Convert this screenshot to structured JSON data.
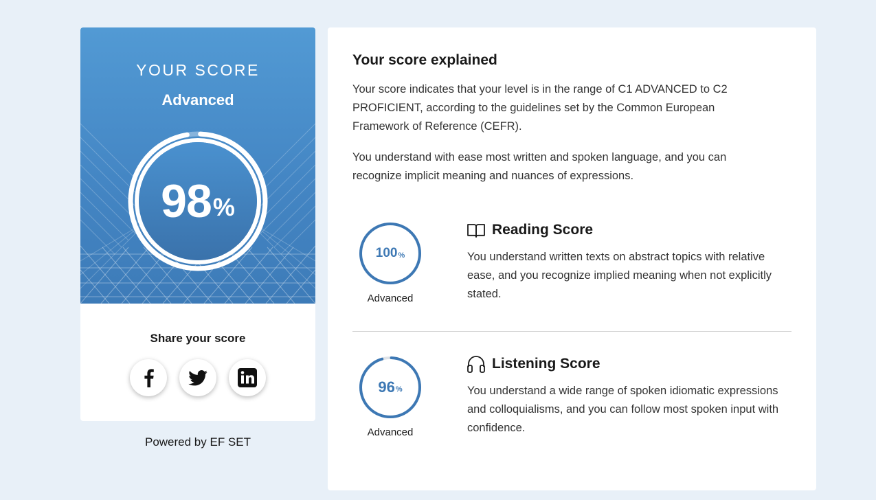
{
  "score_card": {
    "title": "YOUR SCORE",
    "level": "Advanced",
    "score": "98",
    "unit": "%",
    "progress": 0.98,
    "share_title": "Share your score",
    "social": [
      {
        "network": "facebook",
        "icon": "facebook-icon"
      },
      {
        "network": "twitter",
        "icon": "twitter-icon"
      },
      {
        "network": "linkedin",
        "icon": "linkedin-icon"
      }
    ]
  },
  "powered_by": "Powered by EF SET",
  "explanation": {
    "title": "Your score explained",
    "paragraph1": "Your score indicates that your level is in the range of C1 ADVANCED to C2 PROFICIENT, according to the guidelines set by the Common European Framework of Reference (CEFR).",
    "paragraph2": "You understand with ease most written and spoken language, and you can recognize implicit meaning and nuances of expressions."
  },
  "skills": [
    {
      "title": "Reading Score",
      "icon": "book-icon",
      "score": "100",
      "unit": "%",
      "progress": 1.0,
      "level": "Advanced",
      "description": "You understand written texts on abstract topics with relative ease, and you recognize implied meaning when not explicitly stated."
    },
    {
      "title": "Listening Score",
      "icon": "headphones-icon",
      "score": "96",
      "unit": "%",
      "progress": 0.96,
      "level": "Advanced",
      "description": "You understand a wide range of spoken idiomatic expressions and colloquialisms, and you can follow most spoken input with confidence."
    }
  ],
  "colors": {
    "background": "#e8f0f8",
    "hero_blue": "#4a8fcc",
    "ring_blue": "#3d78b4",
    "ring_track": "#dfe3e8"
  }
}
